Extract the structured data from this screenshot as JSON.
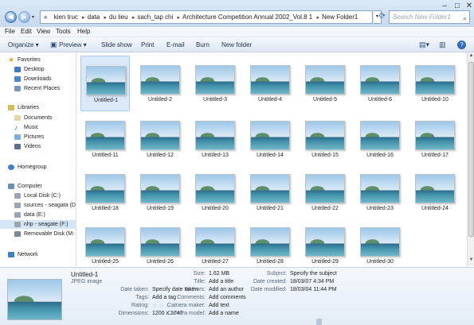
{
  "window": {
    "minimize": "–",
    "maximize": "□",
    "close": "✕"
  },
  "nav": {
    "back_icon": "arrow-left-icon",
    "forward_icon": "arrow-right-icon",
    "dropdown": "▾"
  },
  "address": {
    "prefix": "«",
    "crumbs": [
      "kien truc",
      "data",
      "du lieu",
      "sach_tap chi",
      "Architecture Competition Annual 2002_Vol.8 1",
      "New Folder1"
    ],
    "separator": "▸"
  },
  "search": {
    "placeholder": "Search New Folder1",
    "icon": "search-icon"
  },
  "menubar": [
    "File",
    "Edit",
    "View",
    "Tools",
    "Help"
  ],
  "toolbar": {
    "organize": "Organize ▾",
    "preview": "Preview ▾",
    "slideshow": "Slide show",
    "print": "Print",
    "email": "E-mail",
    "burn": "Burn",
    "new_folder": "New folder",
    "views_icon": "views-icon",
    "pane_icon": "preview-pane-icon",
    "help_icon": "help-icon"
  },
  "sidebar": {
    "favorites_header": "Favorites",
    "favorites": [
      "Desktop",
      "Downloads",
      "Recent Places"
    ],
    "libraries_header": "Libraries",
    "libraries": [
      "Documents",
      "Music",
      "Pictures",
      "Videos"
    ],
    "homegroup": "Homegroup",
    "computer_header": "Computer",
    "drives": [
      "Local Disk (C:)",
      "sources - seagata (D",
      "data (E:)",
      "nhp - seagate (F:)",
      "Removable Disk (M:"
    ],
    "network": "Network"
  },
  "files": [
    "Untitled-1",
    "Untitled-2",
    "Untitled-3",
    "Untitled-4",
    "Untitled-5",
    "Untitled-6",
    "Untitled-10",
    "Untitled-11",
    "Untitled-12",
    "Untitled-13",
    "Untitled-14",
    "Untitled-15",
    "Untitled-16",
    "Untitled-17",
    "Untitled-18",
    "Untitled-19",
    "Untitled-20",
    "Untitled-21",
    "Untitled-22",
    "Untitled-23",
    "Untitled-24",
    "Untitled-25",
    "Untitled-26",
    "Untitled-27",
    "Untitled-28",
    "Untitled-29",
    "Untitled-30"
  ],
  "details": {
    "name": "Untitled-1",
    "type": "JPEG image",
    "date_taken_key": "Date taken:",
    "date_taken_val": "Specify date taken",
    "tags_key": "Tags:",
    "tags_val": "Add a tag",
    "rating_key": "Rating:",
    "rating_stars": 5,
    "rating_value": 0,
    "dimensions_key": "Dimensions:",
    "dimensions_val": "1200 x 1747",
    "size_key": "Size:",
    "size_val": "1.62 MB",
    "title_key": "Title:",
    "title_val": "Add a title",
    "authors_key": "Authors:",
    "authors_val": "Add an author",
    "comments_key": "Comments:",
    "comments_val": "Add comments",
    "camera_maker_key": "Camera maker:",
    "camera_maker_val": "Add text",
    "camera_model_key": "Camera model:",
    "camera_model_val": "Add a name",
    "subject_key": "Subject:",
    "subject_val": "Specify the subject",
    "created_key": "Date created:",
    "created_val": "18/03/07 4:34 PM",
    "modified_key": "Date modified:",
    "modified_val": "18/03/04 11:44 PM"
  },
  "colors": {
    "accent": "#3a6ea8",
    "selection": "#dbe8f8",
    "toolbar": "#dde7f3"
  }
}
